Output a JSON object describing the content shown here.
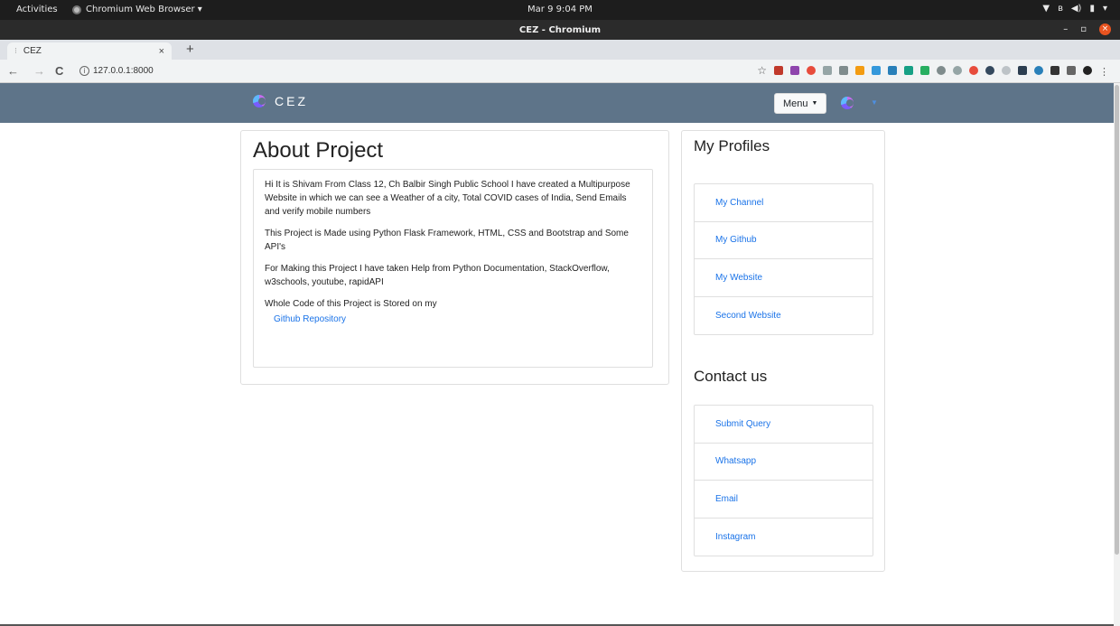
{
  "gnome": {
    "activities": "Activities",
    "app_menu": "Chromium Web Browser ▾",
    "clock": "Mar 9  9:04 PM"
  },
  "window": {
    "title": "CEZ - Chromium",
    "minimize": "–",
    "maximize": "▫",
    "close": "×"
  },
  "tab": {
    "label": "CEZ",
    "close": "×",
    "new_tab": "+"
  },
  "toolbar": {
    "back": "←",
    "forward": "→",
    "reload": "C",
    "info": "i",
    "url": "127.0.0.1:8000",
    "star": "☆"
  },
  "site": {
    "brand": "CEZ",
    "menu_label": "Menu",
    "menu_caret": "▼",
    "user_caret": "▼"
  },
  "about": {
    "title": "About Project",
    "p1": "Hi It is Shivam From Class 12, Ch Balbir Singh Public School I have created a Multipurpose Website in which we can see a Weather of a city, Total COVID cases of India, Send Emails and verify mobile numbers",
    "p2": "This Project is Made using Python Flask Framework, HTML, CSS and Bootstrap and Some API's",
    "p3": "For Making this Project I have taken Help from Python Documentation, StackOverflow, w3schools, youtube, rapidAPI",
    "p4": "Whole Code of this Project is Stored on my",
    "link": "Github Repository"
  },
  "profiles": {
    "title": "My Profiles",
    "items": [
      "My Channel",
      "My Github",
      "My Website",
      "Second Website"
    ]
  },
  "contact": {
    "title": "Contact us",
    "items": [
      "Submit Query",
      "Whatsapp",
      "Email",
      "Instagram"
    ]
  },
  "colors": {
    "navbar": "#5e7489",
    "link": "#1a73e8"
  }
}
